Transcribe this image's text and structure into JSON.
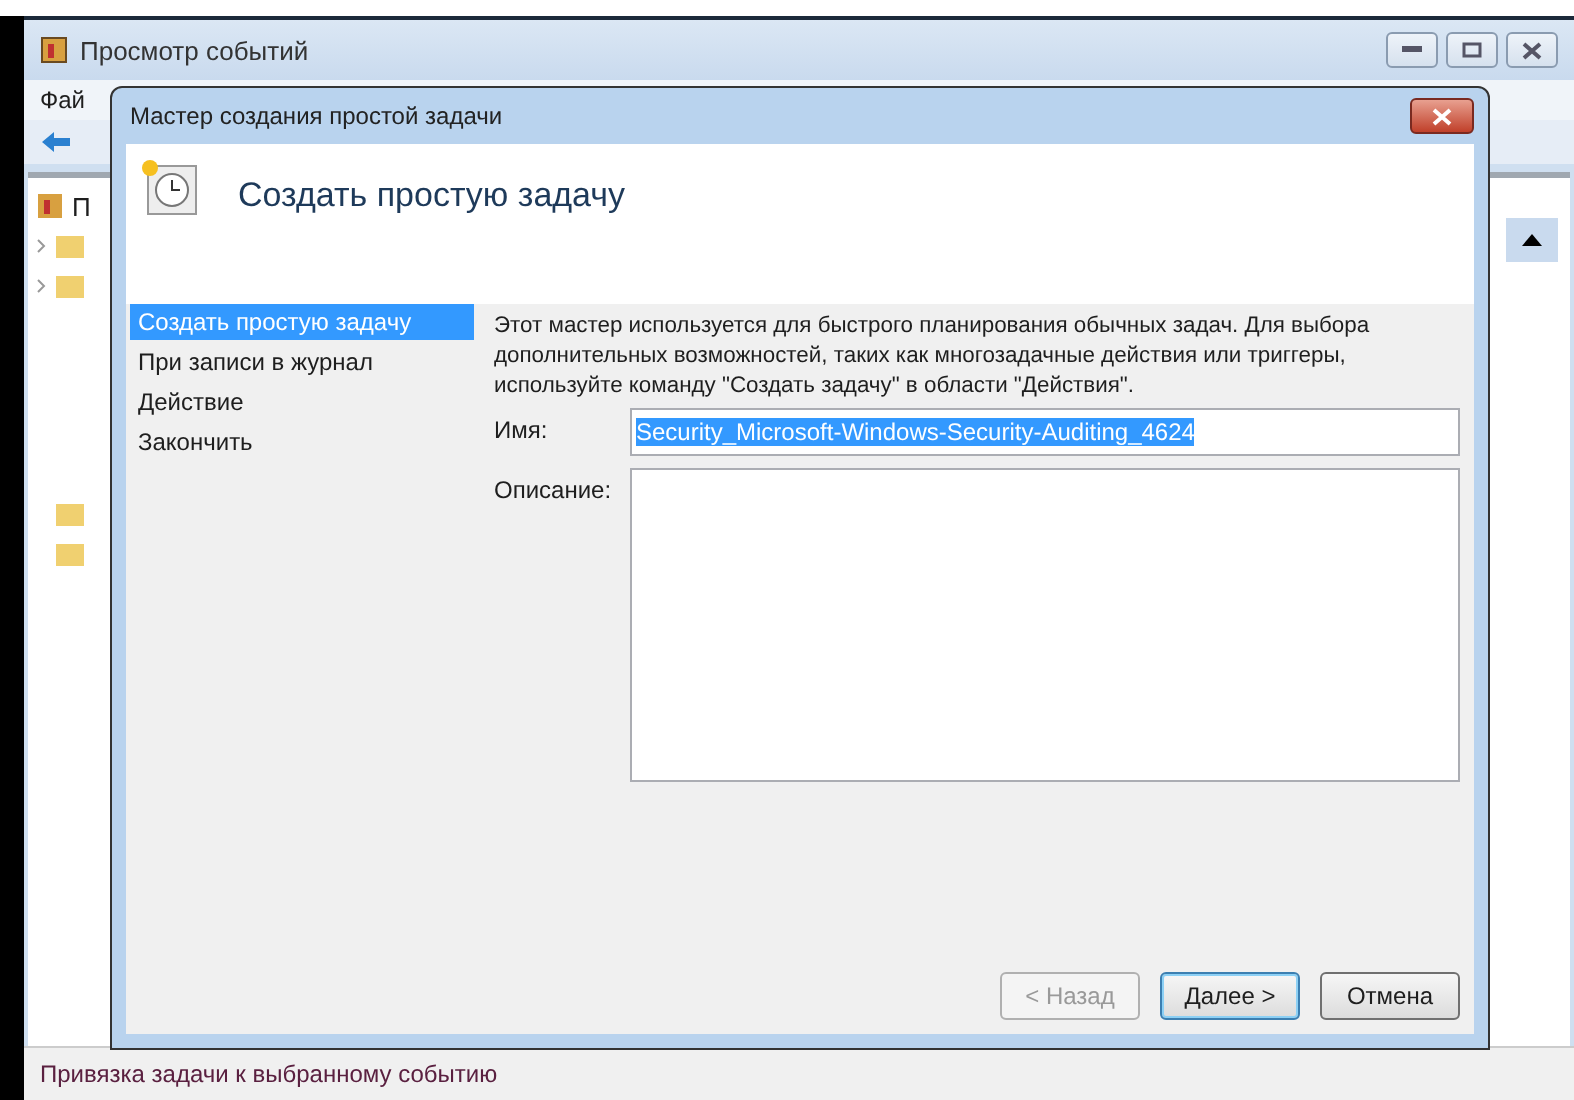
{
  "window": {
    "title": "Просмотр событий",
    "menu": [
      "Фай"
    ],
    "tree_root": "П",
    "status_bar": "Привязка задачи к выбранному событию"
  },
  "dialog": {
    "title": "Мастер создания простой задачи",
    "header_title": "Создать простую задачу",
    "steps": [
      {
        "label": "Создать простую задачу",
        "selected": true
      },
      {
        "label": "При записи в журнал",
        "selected": false
      },
      {
        "label": "Действие",
        "selected": false
      },
      {
        "label": "Закончить",
        "selected": false
      }
    ],
    "description": "Этот мастер используется для быстрого планирования обычных задач.  Для выбора дополнительных возможностей, таких как многозадачные действия или триггеры, используйте команду \"Создать задачу\" в области \"Действия\".",
    "name_field": {
      "label": "Имя:",
      "value": "Security_Microsoft-Windows-Security-Auditing_4624",
      "highlighted": true
    },
    "description_field": {
      "label": "Описание:"
    },
    "buttons": [
      {
        "label": "< Назад",
        "disabled": true,
        "default": false
      },
      {
        "label": "Далее >",
        "disabled": false,
        "default": true
      },
      {
        "label": "Отмена",
        "disabled": false,
        "default": false
      }
    ]
  }
}
